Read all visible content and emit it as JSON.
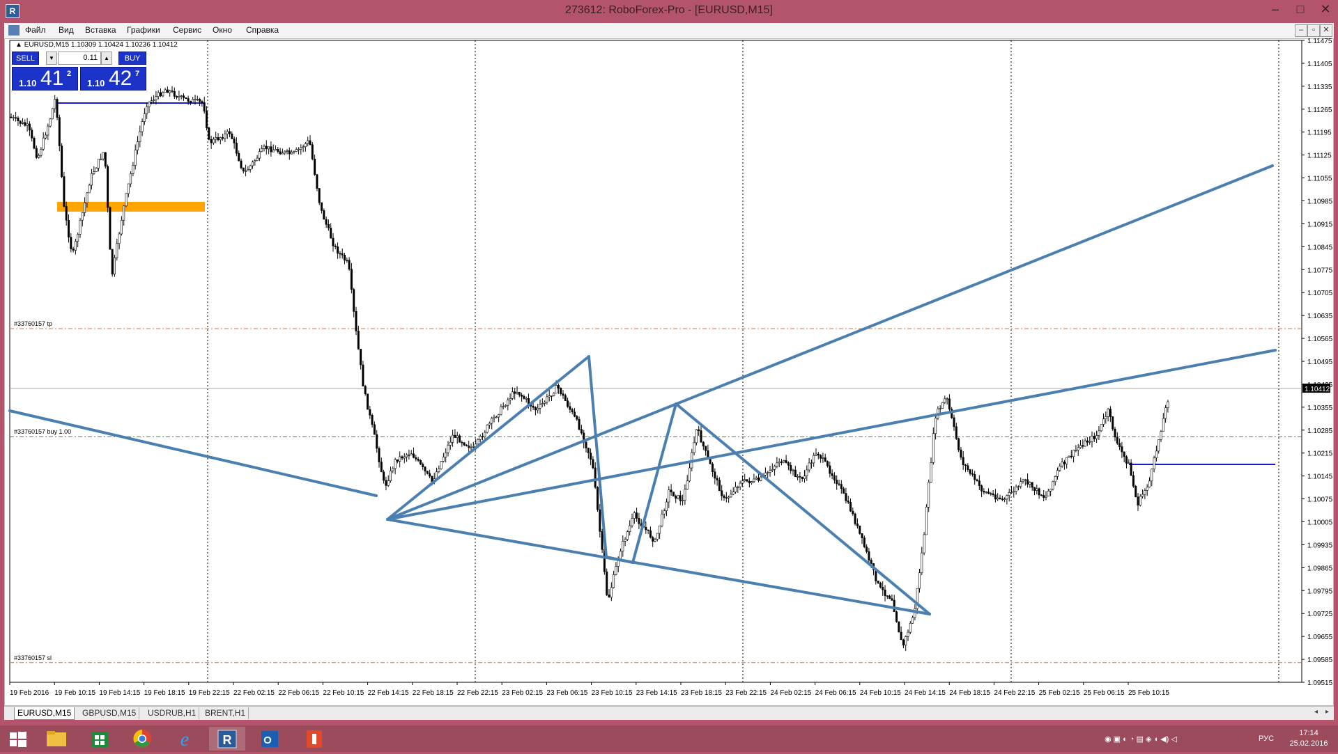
{
  "window": {
    "title": "273612: RoboForex-Pro - [EURUSD,M15]"
  },
  "menu": [
    "Файл",
    "Вид",
    "Вставка",
    "Графики",
    "Сервис",
    "Окно",
    "Справка"
  ],
  "chart": {
    "symbol_line": "EURUSD,M15  1.10309 1.10424 1.10236 1.10412",
    "current_price": "1.10412",
    "y_axis": {
      "min": 1.09515,
      "max": 1.11475,
      "labels": [
        "1.11475",
        "1.11405",
        "1.11335",
        "1.11265",
        "1.11195",
        "1.11125",
        "1.11055",
        "1.10985",
        "1.10915",
        "1.10845",
        "1.10775",
        "1.10705",
        "1.10635",
        "1.10565",
        "1.10495",
        "1.10425",
        "1.10355",
        "1.10285",
        "1.10215",
        "1.10145",
        "1.10075",
        "1.10005",
        "1.09935",
        "1.09865",
        "1.09795",
        "1.09725",
        "1.09655",
        "1.09585",
        "1.09515"
      ]
    },
    "x_axis": {
      "labels": [
        "19 Feb 2016",
        "19 Feb 10:15",
        "19 Feb 14:15",
        "19 Feb 18:15",
        "19 Feb 22:15",
        "22 Feb 02:15",
        "22 Feb 06:15",
        "22 Feb 10:15",
        "22 Feb 14:15",
        "22 Feb 18:15",
        "22 Feb 22:15",
        "23 Feb 02:15",
        "23 Feb 06:15",
        "23 Feb 10:15",
        "23 Feb 14:15",
        "23 Feb 18:15",
        "23 Feb 22:15",
        "24 Feb 02:15",
        "24 Feb 06:15",
        "24 Feb 10:15",
        "24 Feb 14:15",
        "24 Feb 18:15",
        "24 Feb 22:15",
        "25 Feb 02:15",
        "25 Feb 06:15",
        "25 Feb 10:15"
      ]
    },
    "order_lines": [
      {
        "label": "#33760157 tp",
        "price": 1.10595,
        "color": "#e0703a"
      },
      {
        "label": "#33760157 buy 1.00",
        "price": 1.10265,
        "color": "#3a8a3a"
      },
      {
        "label": "#33760157 sl",
        "price": 1.09575,
        "color": "#e0703a"
      }
    ],
    "colors": {
      "trendline": "#4a7fb0",
      "candle": "#000000",
      "orange_zone": "#ffa500",
      "level_line": "#1a1acc"
    }
  },
  "trade_panel": {
    "sell_label": "SELL",
    "buy_label": "BUY",
    "lot": "0.11",
    "sell_small": "1.10",
    "sell_big": "41",
    "sell_sup": "2",
    "buy_small": "1.10",
    "buy_big": "42",
    "buy_sup": "7"
  },
  "tabs": [
    "EURUSD,M15",
    "GBPUSD,M15",
    "USDRUB,H1",
    "BRENT,H1"
  ],
  "taskbar": {
    "icons": [
      "start-icon",
      "file-explorer-icon",
      "store-icon",
      "chrome-icon",
      "internet-explorer-icon",
      "roboforex-icon",
      "outlook-icon",
      "media-app-icon"
    ],
    "lang": "РУС",
    "time": "17:14",
    "date": "25.02.2016"
  }
}
